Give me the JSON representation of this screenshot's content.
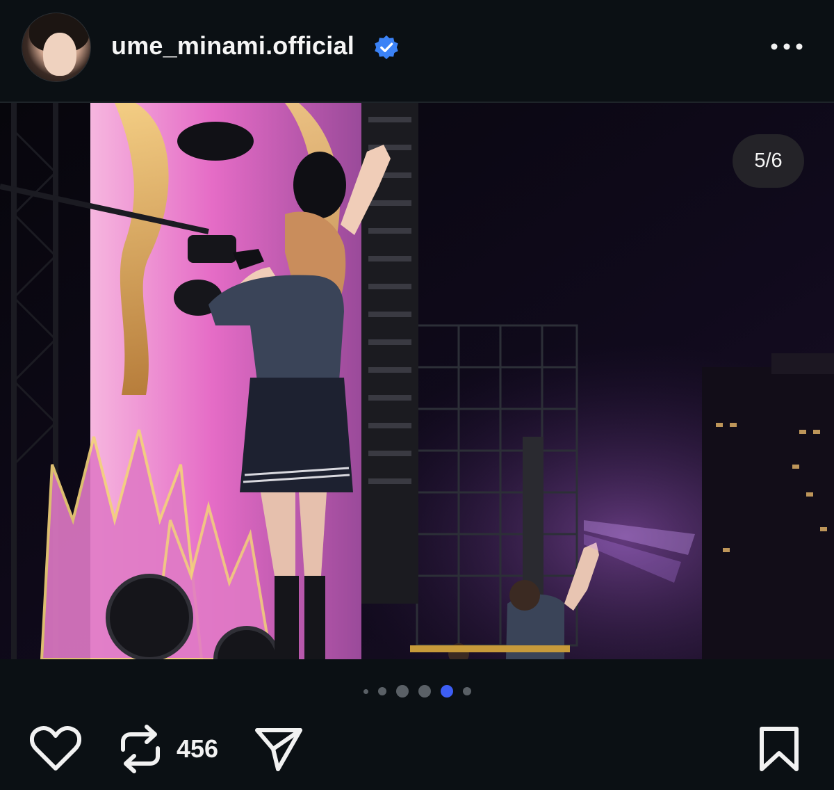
{
  "post": {
    "username": "ume_minami.official",
    "verified": true,
    "avatar_icon": "profile-avatar",
    "more_icon": "more-options-icon"
  },
  "carousel": {
    "counter": "5/6",
    "current": 5,
    "total": 6
  },
  "actions": {
    "repost_count": "456",
    "like_icon": "heart-icon",
    "repost_icon": "repost-icon",
    "share_icon": "send-icon",
    "save_icon": "bookmark-icon"
  },
  "colors": {
    "background": "#0b1014",
    "verified_badge": "#3b82f6",
    "active_dot": "#3d5ef5",
    "inactive_dot": "#5a6066"
  }
}
